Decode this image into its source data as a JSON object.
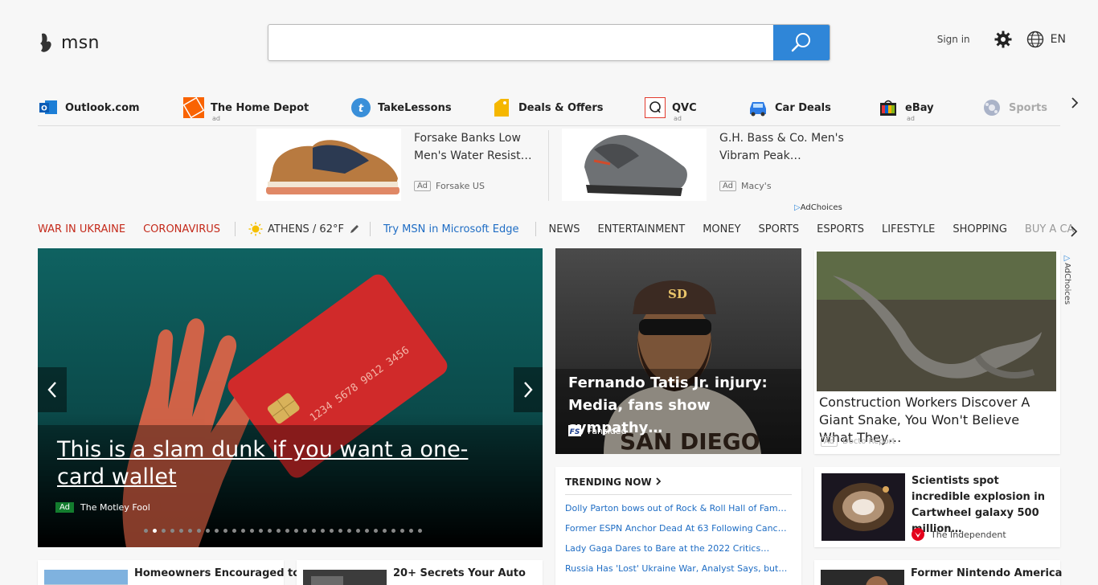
{
  "header": {
    "logo_text": "msn",
    "search_placeholder": "",
    "signin_label": "Sign in",
    "lang_label": "EN"
  },
  "quicklinks": [
    {
      "label": "Outlook.com",
      "icon": "outlook-icon",
      "ad": ""
    },
    {
      "label": "The Home Depot",
      "icon": "home-depot-icon",
      "ad": "ad"
    },
    {
      "label": "TakeLessons",
      "icon": "takelessons-icon",
      "ad": ""
    },
    {
      "label": "Deals & Offers",
      "icon": "deals-tag-icon",
      "ad": ""
    },
    {
      "label": "QVC",
      "icon": "qvc-icon",
      "ad": "ad"
    },
    {
      "label": "Car Deals",
      "icon": "car-icon",
      "ad": ""
    },
    {
      "label": "eBay",
      "icon": "ebay-icon",
      "ad": "ad"
    },
    {
      "label": "Sports",
      "icon": "sports-icon",
      "ad": ""
    }
  ],
  "ads": [
    {
      "title": "Forsake Banks Low Men's Water Resist…",
      "badge": "Ad",
      "source": "Forsake US"
    },
    {
      "title": "G.H. Bass & Co. Men's Vibram Peak…",
      "badge": "Ad",
      "source": "Macy's"
    }
  ],
  "adchoices": "AdChoices",
  "nav": {
    "hot1": "WAR IN UKRAINE",
    "hot2": "CORONAVIRUS",
    "weather": "ATHENS / 62°F",
    "edge": "Try MSN in Microsoft Edge",
    "items": [
      "NEWS",
      "ENTERTAINMENT",
      "MONEY",
      "SPORTS",
      "ESPORTS",
      "LIFESTYLE",
      "SHOPPING"
    ],
    "faded": "BUY A CA"
  },
  "hero": {
    "title": "This is a slam dunk if you want a one-card wallet",
    "badge": "Ad",
    "source": "The Motley Fool",
    "card_digits": "1234 5678 9012 3456",
    "dot_count": 32,
    "active_dot": 1
  },
  "tatis": {
    "title": "Fernando Tatis Jr. injury: Media, fans show sympathy…",
    "source": "Fansided",
    "cap_logo": "SD",
    "jersey_text": "SAN DIEGO"
  },
  "snake": {
    "title": "Construction Workers Discover A Giant Snake, You Won't Believe What They…",
    "badge": "Ad",
    "source": "Docto Report"
  },
  "trending": {
    "heading": "TRENDING NOW",
    "items": [
      "Dolly Parton bows out of Rock & Roll Hall of Fame…",
      "Former ESPN Anchor Dead At 63 Following Cancer…",
      "Lady Gaga Dares to Bare at the 2022 Critics…",
      "Russia Has 'Lost' Ukraine War, Analyst Says, but…"
    ]
  },
  "science": {
    "title": "Scientists spot incredible explosion in Cartwheel galaxy 500 million…",
    "source": "The Independent"
  },
  "bottom": [
    {
      "title": "Homeowners Encouraged to"
    },
    {
      "title": "20+ Secrets Your Auto"
    },
    {
      "title": "Former Nintendo America"
    }
  ]
}
